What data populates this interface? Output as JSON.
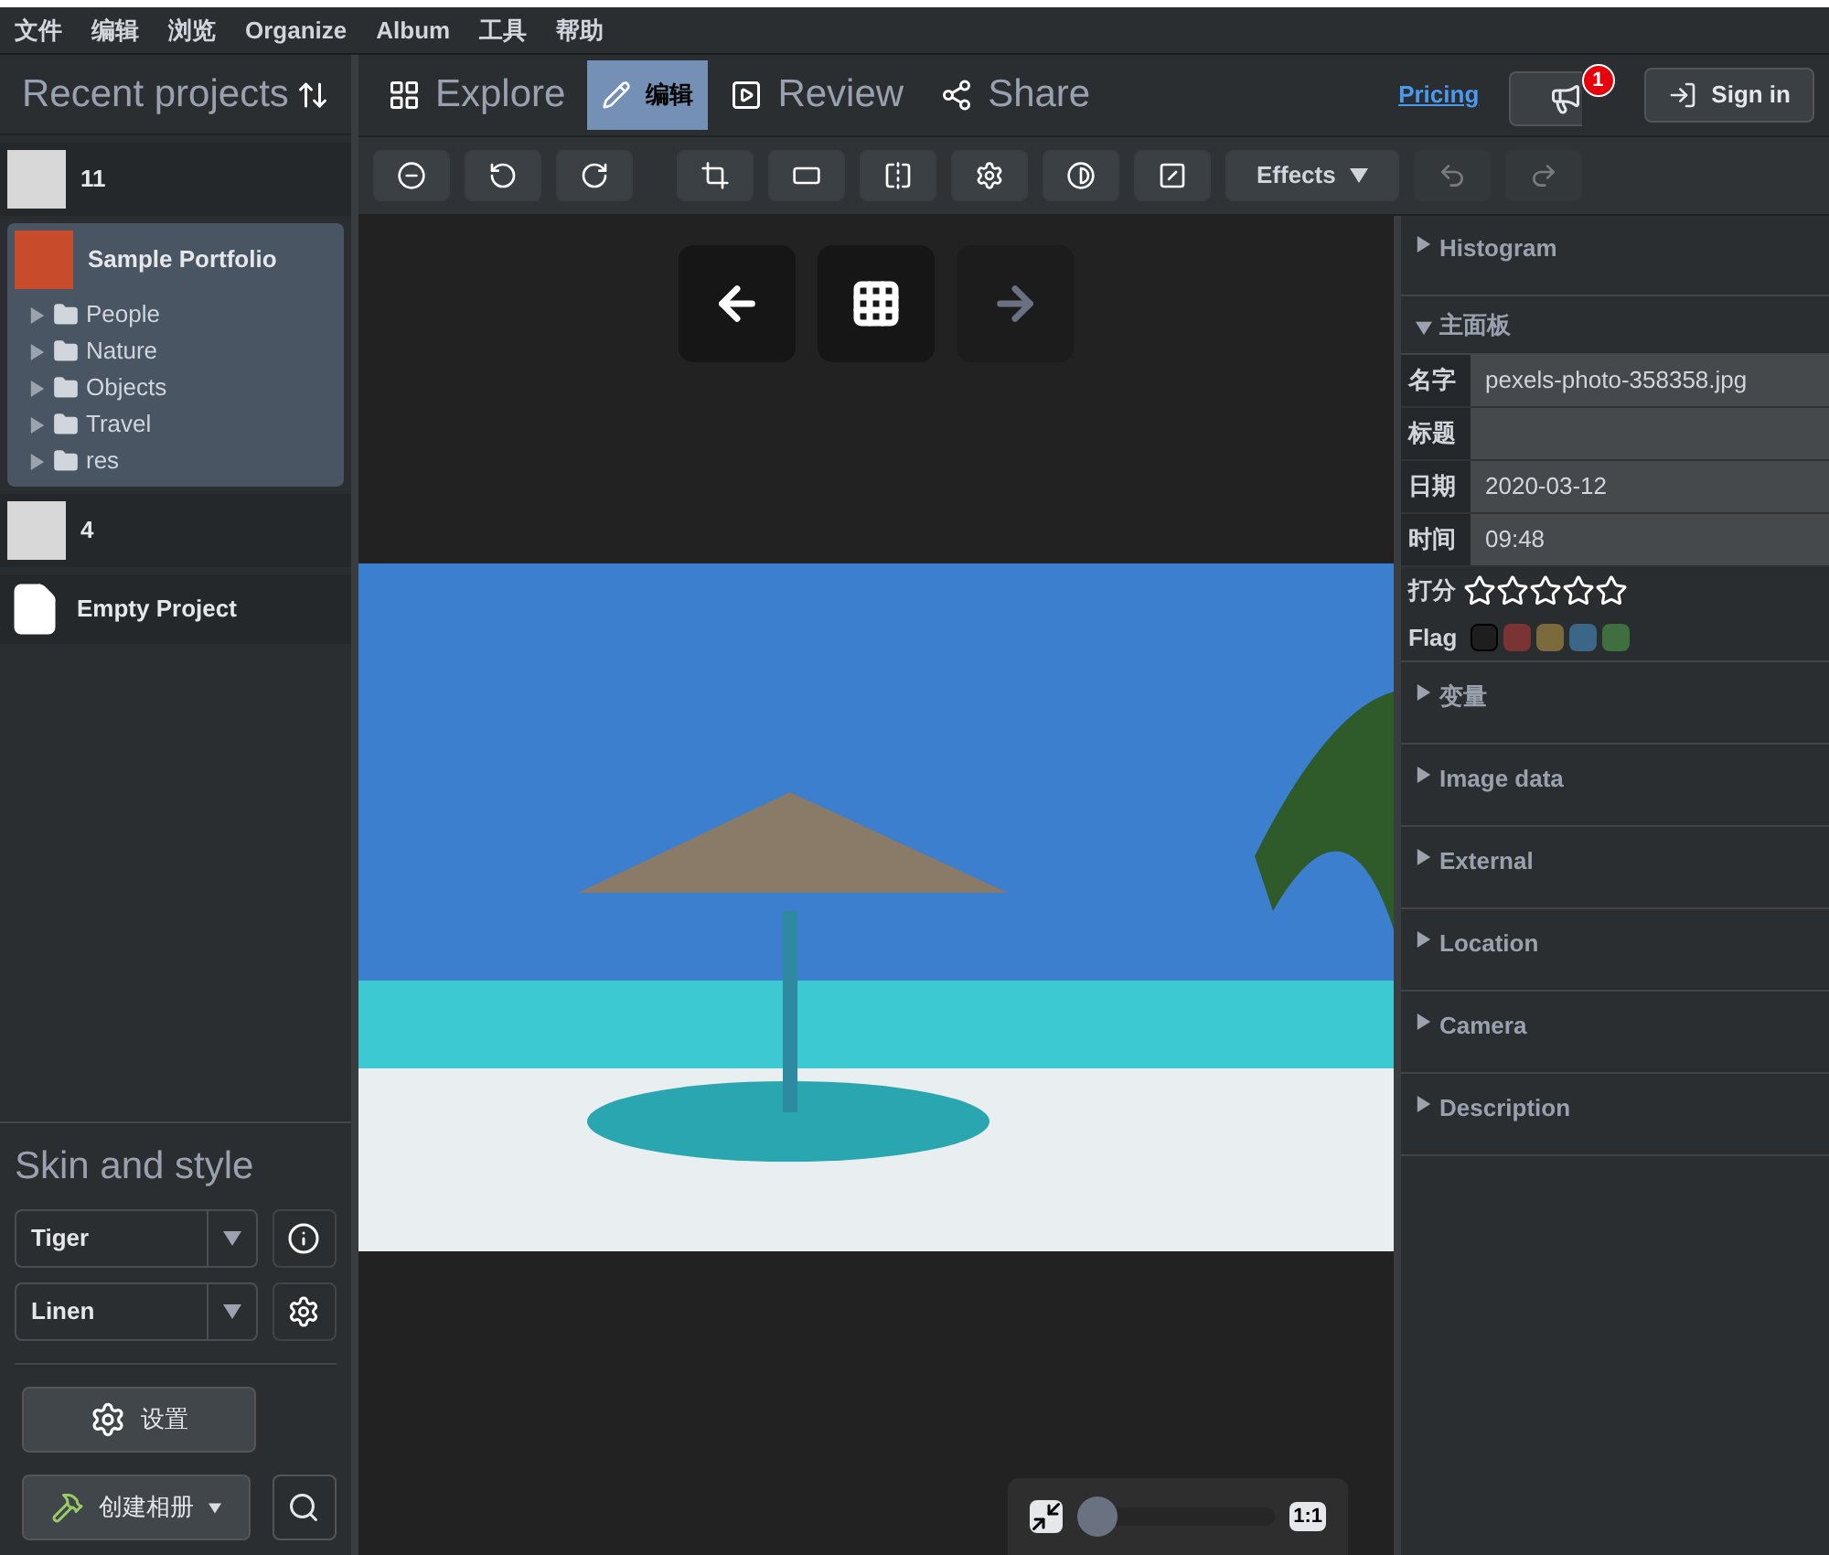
{
  "menu": [
    "文件",
    "编辑",
    "浏览",
    "Organize",
    "Album",
    "工具",
    "帮助"
  ],
  "sidebar": {
    "title": "Recent projects",
    "projects": [
      {
        "name": "11",
        "selected": false
      },
      {
        "name": "Sample Portfolio",
        "selected": true,
        "children": [
          {
            "name": "People",
            "expanded": false
          },
          {
            "name": "Nature",
            "expanded": false
          },
          {
            "name": "Objects",
            "expanded": false
          },
          {
            "name": "Travel",
            "expanded": false
          },
          {
            "name": "res",
            "expanded": false
          }
        ]
      },
      {
        "name": "4",
        "selected": false
      },
      {
        "name": "Empty Project",
        "selected": false
      }
    ],
    "skin_title": "Skin and style",
    "skin": "Tiger",
    "style": "Linen",
    "settings_button": "设置",
    "create_button": "创建相册"
  },
  "tabs": [
    {
      "label": "Explore",
      "selected": false
    },
    {
      "label": "编辑",
      "selected": true
    },
    {
      "label": "Review",
      "selected": false
    },
    {
      "label": "Share",
      "selected": false
    }
  ],
  "pricing": "Pricing",
  "notifications": "1",
  "sign_in": "Sign in",
  "toolbar": {
    "effects": "Effects",
    "undo_disabled": true,
    "redo_disabled": true
  },
  "zoom": {
    "level": 0,
    "one_to_one": "1:1"
  },
  "panel": {
    "sections_top": [
      {
        "title": "Histogram",
        "expanded": false
      },
      {
        "title": "主面板",
        "expanded": true
      }
    ],
    "fields": [
      {
        "label": "名字",
        "value": "pexels-photo-358358.jpg"
      },
      {
        "label": "标题"
      },
      {
        "label": "日期",
        "value": "2020-03-12"
      },
      {
        "label": "时间",
        "value": "09:48"
      }
    ],
    "rating_label": "打分",
    "stars": 0,
    "flag_label": "Flag",
    "flags": [
      {
        "color": "#1e1e1e",
        "selected": true
      },
      {
        "color": "#7a3434",
        "selected": false
      },
      {
        "color": "#7a6a3c",
        "selected": false
      },
      {
        "color": "#3c6688",
        "selected": false
      },
      {
        "color": "#3f6e3f",
        "selected": false
      }
    ],
    "sections": [
      {
        "title": "变量",
        "expanded": false
      },
      {
        "title": "Image data",
        "expanded": false
      },
      {
        "title": "External",
        "expanded": false
      },
      {
        "title": "Location",
        "expanded": false
      },
      {
        "title": "Camera",
        "expanded": false
      },
      {
        "title": "Description",
        "expanded": false
      }
    ]
  }
}
